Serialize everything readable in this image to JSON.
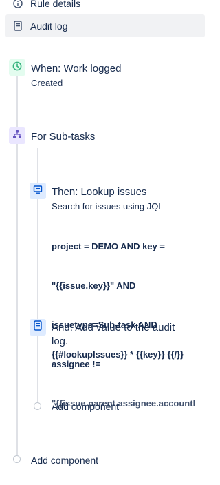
{
  "nav": {
    "rule_details": "Rule details",
    "audit_log": "Audit log"
  },
  "trigger": {
    "title": "When: Work logged",
    "subtitle": "Created",
    "icon": "clock-icon"
  },
  "branch": {
    "title": "For Sub-tasks",
    "icon": "hierarchy-icon"
  },
  "lookup": {
    "title": "Then: Lookup issues",
    "subtitle": "Search for issues using JQL",
    "jql_line1": "project = DEMO AND key =",
    "jql_line2": "\"{{issue.key}}\" AND",
    "jql_line3": "issuetype=Sub-task AND",
    "jql_line4": "assignee !=",
    "jql_line5": "\"{{issue.parent.assignee.accountI",
    "icon": "monitor-icon"
  },
  "audit": {
    "title_line1": "And: Add value to the audit",
    "title_line2": "log.",
    "value": "{{#lookupIssues}} * {{key}} {{/}}",
    "icon": "document-icon"
  },
  "add_component_inner": "Add component",
  "add_component_outer": "Add component",
  "colors": {
    "trigger_green": "#36b37e",
    "branch_purple": "#6554c0",
    "action_blue": "#0052cc"
  }
}
